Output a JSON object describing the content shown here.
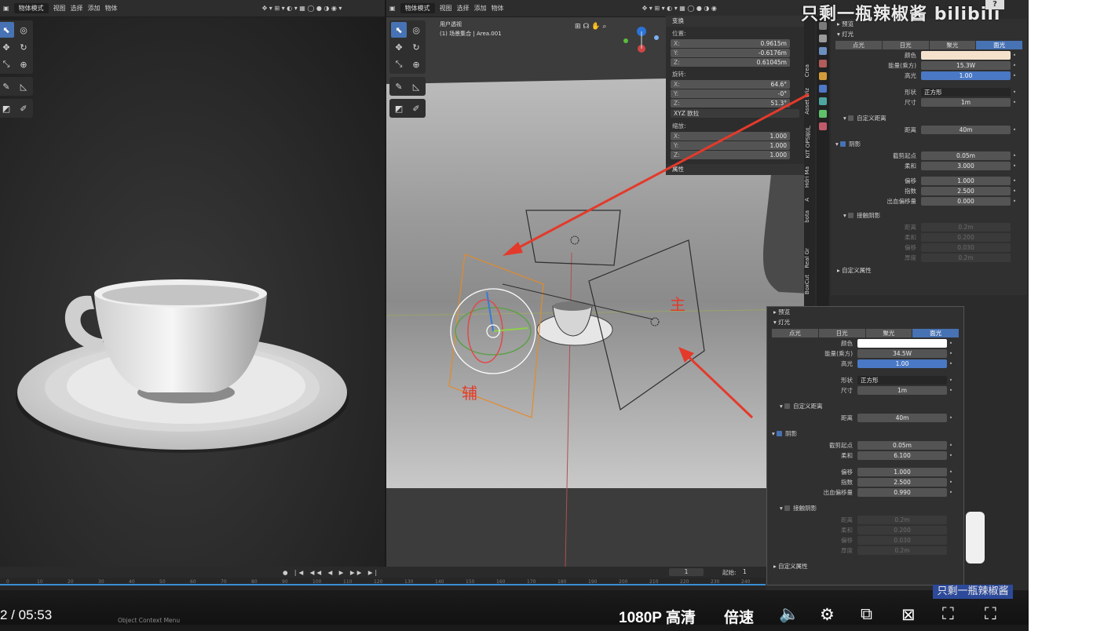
{
  "left_header": {
    "mode": "物体模式",
    "menu": [
      "视图",
      "选择",
      "添加",
      "物体"
    ]
  },
  "right_header": {
    "mode": "物体模式",
    "menu": [
      "视图",
      "选择",
      "添加",
      "物体"
    ]
  },
  "viewport_info": {
    "view": "用户透视",
    "scene": "(1) 场景集合 | Area.001"
  },
  "transform": {
    "title": "变换",
    "location_label": "位置:",
    "location": [
      {
        "k": "X:",
        "v": "0.9615m"
      },
      {
        "k": "Y:",
        "v": "-0.6176m"
      },
      {
        "k": "Z:",
        "v": "0.61045m"
      }
    ],
    "rotation_label": "旋转:",
    "rotation": [
      {
        "k": "X:",
        "v": "64.6°"
      },
      {
        "k": "Y:",
        "v": "-0°"
      },
      {
        "k": "Z:",
        "v": "51.3°"
      }
    ],
    "rotation_mode": "XYZ 欧拉",
    "scale_label": "缩放:",
    "scale": [
      {
        "k": "X:",
        "v": "1.000"
      },
      {
        "k": "Y:",
        "v": "1.000"
      },
      {
        "k": "Z:",
        "v": "1.000"
      }
    ],
    "props_label": "属性"
  },
  "side_tabs": [
    "Crea",
    "Asset Wiz",
    "KIT OPS资产",
    "Hdri Ma",
    "A",
    "bota",
    "",
    "Real Gr",
    "BoxCut"
  ],
  "light_panel_main": {
    "preview": "预览",
    "light": "灯光",
    "types": [
      "点光",
      "日光",
      "聚光",
      "面光"
    ],
    "active_type": 3,
    "color_label": "颜色",
    "energy_label": "能量(乘方)",
    "energy": "15.3W",
    "spec_label": "高光",
    "spec": "1.00",
    "shape_label": "形状",
    "shape": "正方形",
    "size_label": "尺寸",
    "size": "1m",
    "custom_dist": "自定义距离",
    "dist_label": "距离",
    "dist": "40m",
    "shadow": "阴影",
    "clip_label": "截剪起点",
    "clip": "0.05m",
    "soft_label": "柔和",
    "soft": "3.000",
    "bias_label": "偏移",
    "bias": "1.000",
    "exp_label": "指数",
    "exp": "2.500",
    "bleed_label": "出血偏移量",
    "bleed": "0.000",
    "contact": "接触阴影",
    "c_dist_label": "距离",
    "c_dist": "0.2m",
    "c_soft_label": "柔和",
    "c_soft": "0.200",
    "c_bias_label": "偏移",
    "c_bias": "0.030",
    "c_thick_label": "厚度",
    "c_thick": "0.2m",
    "custom_props": "自定义属性"
  },
  "light_panel_overlay": {
    "preview": "预览",
    "light": "灯光",
    "types": [
      "点光",
      "日光",
      "聚光",
      "面光"
    ],
    "color_label": "颜色",
    "energy_label": "能量(乘方)",
    "energy": "34.5W",
    "spec_label": "高光",
    "spec": "1.00",
    "shape_label": "形状",
    "shape": "正方形",
    "size_label": "尺寸",
    "size": "1m",
    "custom_dist": "自定义距离",
    "dist_label": "距离",
    "dist": "40m",
    "shadow": "阴影",
    "clip_label": "截剪起点",
    "clip": "0.05m",
    "soft_label": "柔和",
    "soft": "6.100",
    "bias_label": "偏移",
    "bias": "1.000",
    "exp_label": "指数",
    "exp": "2.500",
    "bleed_label": "出血偏移量",
    "bleed": "0.990",
    "contact": "接触阴影",
    "c_dist_label": "距离",
    "c_dist": "0.2m",
    "c_soft_label": "柔和",
    "c_soft": "0.200",
    "c_bias_label": "偏移",
    "c_bias": "0.030",
    "c_thick_label": "厚度",
    "c_thick": "0.2m",
    "custom_props": "自定义属性"
  },
  "annotations": {
    "fill": "辅",
    "key": "主"
  },
  "timeline": {
    "frame": "1",
    "start_label": "起始:",
    "start": "1",
    "ticks": [
      "0",
      "10",
      "20",
      "30",
      "40",
      "50",
      "60",
      "70",
      "80",
      "90",
      "100",
      "110",
      "120",
      "130",
      "140",
      "150",
      "160",
      "170",
      "180",
      "190",
      "200",
      "210",
      "220",
      "230",
      "240"
    ]
  },
  "player": {
    "time": "2 / 05:53",
    "quality": "1080P 高清",
    "speed": "倍速",
    "context_menu": "Object Context Menu"
  },
  "watermark": {
    "text": "只剩一瓶辣椒酱",
    "logo": "bilibili",
    "help": "?",
    "badge": "只剩一瓶辣椒酱"
  },
  "colors": {
    "accent": "#4772b3",
    "arrow": "#e33a2b",
    "timeline": "#3a8fd6"
  }
}
